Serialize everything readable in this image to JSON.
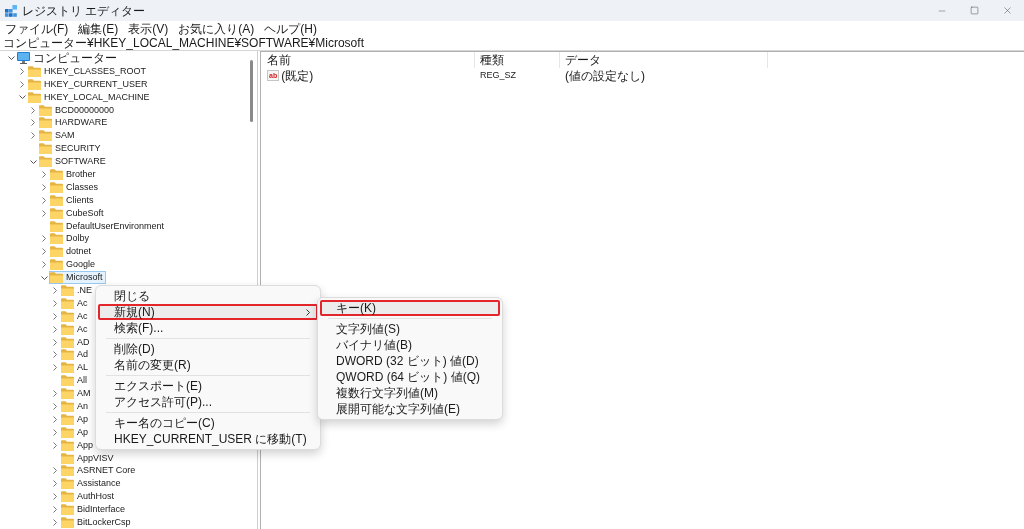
{
  "window": {
    "title": "レジストリ エディター"
  },
  "menu_bar": [
    "ファイル(F)",
    "編集(E)",
    "表示(V)",
    "お気に入り(A)",
    "ヘルプ(H)"
  ],
  "address_bar": {
    "value": "コンピューター¥HKEY_LOCAL_MACHINE¥SOFTWARE¥Microsoft"
  },
  "tree": [
    {
      "label": "コンピューター",
      "kind": "computer",
      "expanded": true,
      "selected": false,
      "children": [
        {
          "label": "HKEY_CLASSES_ROOT",
          "kind": "key",
          "expanded": false,
          "selected": false
        },
        {
          "label": "HKEY_CURRENT_USER",
          "kind": "key",
          "expanded": false,
          "selected": false
        },
        {
          "label": "HKEY_LOCAL_MACHINE",
          "kind": "key",
          "expanded": true,
          "selected": false,
          "children": [
            {
              "label": "BCD00000000",
              "kind": "key",
              "expanded": false,
              "selected": false
            },
            {
              "label": "HARDWARE",
              "kind": "key",
              "expanded": false,
              "selected": false
            },
            {
              "label": "SAM",
              "kind": "key",
              "expanded": false,
              "selected": false
            },
            {
              "label": "SECURITY",
              "kind": "key",
              "selected": false
            },
            {
              "label": "SOFTWARE",
              "kind": "key",
              "expanded": true,
              "selected": false,
              "children": [
                {
                  "label": "Brother",
                  "kind": "key",
                  "expanded": false,
                  "selected": false
                },
                {
                  "label": "Classes",
                  "kind": "key",
                  "expanded": false,
                  "selected": false
                },
                {
                  "label": "Clients",
                  "kind": "key",
                  "expanded": false,
                  "selected": false
                },
                {
                  "label": "CubeSoft",
                  "kind": "key",
                  "expanded": false,
                  "selected": false
                },
                {
                  "label": "DefaultUserEnvironment",
                  "kind": "key",
                  "selected": false
                },
                {
                  "label": "Dolby",
                  "kind": "key",
                  "expanded": false,
                  "selected": false
                },
                {
                  "label": "dotnet",
                  "kind": "key",
                  "expanded": false,
                  "selected": false
                },
                {
                  "label": "Google",
                  "kind": "key",
                  "expanded": false,
                  "selected": false
                },
                {
                  "label": "Microsoft",
                  "kind": "key",
                  "expanded": true,
                  "selected": true,
                  "children": [
                    {
                      "label": ".NE",
                      "kind": "key",
                      "expanded": false,
                      "selected": false
                    },
                    {
                      "label": "Ac",
                      "kind": "key",
                      "expanded": false,
                      "selected": false
                    },
                    {
                      "label": "Ac",
                      "kind": "key",
                      "expanded": false,
                      "selected": false
                    },
                    {
                      "label": "Ac",
                      "kind": "key",
                      "expanded": false,
                      "selected": false
                    },
                    {
                      "label": "AD",
                      "kind": "key",
                      "expanded": false,
                      "selected": false
                    },
                    {
                      "label": "Ad",
                      "kind": "key",
                      "expanded": false,
                      "selected": false
                    },
                    {
                      "label": "AL",
                      "kind": "key",
                      "expanded": false,
                      "selected": false
                    },
                    {
                      "label": "All",
                      "kind": "key",
                      "selected": false
                    },
                    {
                      "label": "AM",
                      "kind": "key",
                      "expanded": false,
                      "selected": false
                    },
                    {
                      "label": "An",
                      "kind": "key",
                      "expanded": false,
                      "selected": false
                    },
                    {
                      "label": "Ap",
                      "kind": "key",
                      "expanded": false,
                      "selected": false
                    },
                    {
                      "label": "Ap",
                      "kind": "key",
                      "expanded": false,
                      "selected": false
                    },
                    {
                      "label": "App",
                      "kind": "key",
                      "expanded": false,
                      "selected": false
                    },
                    {
                      "label": "AppVISV",
                      "kind": "key",
                      "selected": false
                    },
                    {
                      "label": "ASRNET Core",
                      "kind": "key",
                      "expanded": false,
                      "selected": false
                    },
                    {
                      "label": "Assistance",
                      "kind": "key",
                      "expanded": false,
                      "selected": false
                    },
                    {
                      "label": "AuthHost",
                      "kind": "key",
                      "expanded": false,
                      "selected": false
                    },
                    {
                      "label": "BidInterface",
                      "kind": "key",
                      "expanded": false,
                      "selected": false
                    },
                    {
                      "label": "BitLockerCsp",
                      "kind": "key",
                      "expanded": false,
                      "selected": false
                    }
                  ]
                }
              ]
            }
          ]
        }
      ]
    }
  ],
  "values_list": {
    "columns": [
      "名前",
      "種類",
      "データ"
    ],
    "rows": [
      {
        "type_icon": "ab",
        "name": "(既定)",
        "type": "REG_SZ",
        "data": "(値の設定なし)"
      }
    ]
  },
  "context_menu": {
    "items": [
      {
        "kind": "item",
        "label": "閉じる",
        "selected": false
      },
      {
        "kind": "submenu",
        "label": "新規(N)",
        "selected": true
      },
      {
        "kind": "item",
        "label": "検索(F)...",
        "selected": false
      },
      {
        "kind": "separator"
      },
      {
        "kind": "item",
        "label": "削除(D)",
        "selected": false
      },
      {
        "kind": "item",
        "label": "名前の変更(R)",
        "selected": false
      },
      {
        "kind": "separator"
      },
      {
        "kind": "item",
        "label": "エクスポート(E)",
        "selected": false
      },
      {
        "kind": "item",
        "label": "アクセス許可(P)...",
        "selected": false
      },
      {
        "kind": "separator"
      },
      {
        "kind": "item",
        "label": "キー名のコピー(C)",
        "selected": false
      },
      {
        "kind": "item",
        "label": "HKEY_CURRENT_USER に移動(T)",
        "selected": false
      }
    ]
  },
  "submenu": {
    "items": [
      {
        "kind": "item",
        "label": "キー(K)",
        "selected": true
      },
      {
        "kind": "separator"
      },
      {
        "kind": "item",
        "label": "文字列値(S)",
        "selected": false
      },
      {
        "kind": "item",
        "label": "バイナリ値(B)",
        "selected": false
      },
      {
        "kind": "item",
        "label": "DWORD (32 ビット) 値(D)",
        "selected": false
      },
      {
        "kind": "item",
        "label": "QWORD (64 ビット) 値(Q)",
        "selected": false
      },
      {
        "kind": "item",
        "label": "複数行文字列値(M)",
        "selected": false
      },
      {
        "kind": "item",
        "label": "展開可能な文字列値(E)",
        "selected": false
      }
    ]
  }
}
